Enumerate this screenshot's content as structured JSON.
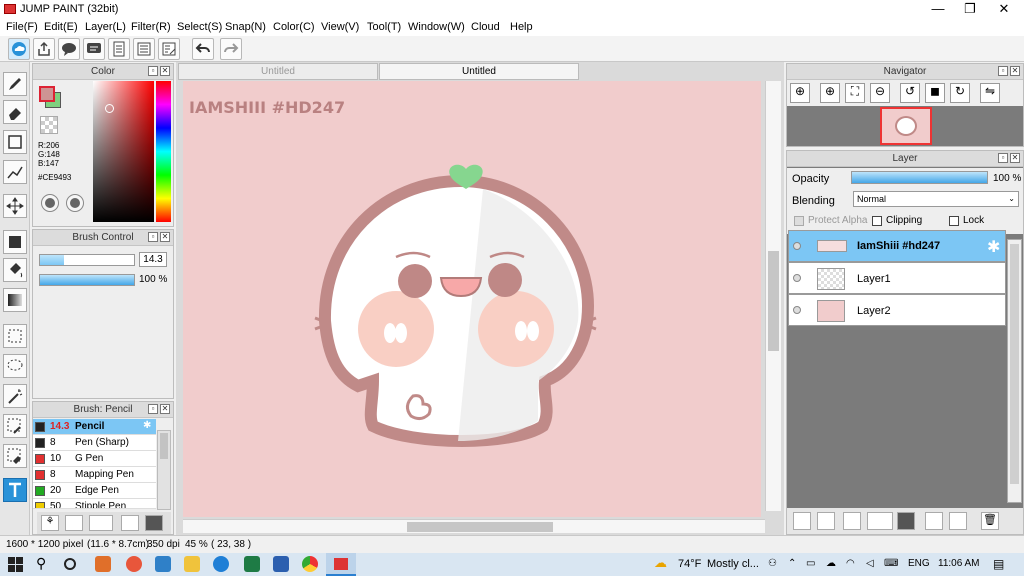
{
  "window": {
    "title": "JUMP PAINT (32bit)",
    "minimize": "—",
    "maximize": "❐",
    "close": "✕"
  },
  "menu": [
    "File(F)",
    "Edit(E)",
    "Layer(L)",
    "Filter(R)",
    "Select(S)",
    "Snap(N)",
    "Color(C)",
    "View(V)",
    "Tool(T)",
    "Window(W)",
    "Cloud",
    "Help"
  ],
  "color_panel": {
    "title": "Color",
    "r": "R:206",
    "g": "G:148",
    "b": "B:147",
    "hex": "#CE9493",
    "fg_color": "#CE9493",
    "bg_color": "#7fd07f"
  },
  "brush_control": {
    "title": "Brush Control",
    "size": "14.3",
    "opacity": "100 %",
    "size_fill": 0.25,
    "opacity_fill": 1.0
  },
  "brush_panel": {
    "title": "Brush: Pencil",
    "items": [
      {
        "size": "14.3",
        "name": "Pencil",
        "color": "#222222",
        "selected": true
      },
      {
        "size": "8",
        "name": "Pen (Sharp)",
        "color": "#222222"
      },
      {
        "size": "10",
        "name": "G Pen",
        "color": "#e23030"
      },
      {
        "size": "8",
        "name": "Mapping Pen",
        "color": "#e23030"
      },
      {
        "size": "20",
        "name": "Edge Pen",
        "color": "#22aa22"
      },
      {
        "size": "50",
        "name": "Stipple Pen",
        "color": "#eecc00"
      }
    ]
  },
  "tabs": {
    "inactive": "Untitled",
    "active": "Untitled"
  },
  "canvas": {
    "watermark": "IAMSHIII #HD247",
    "background": "#f1cccc"
  },
  "navigator": {
    "title": "Navigator"
  },
  "layer_panel": {
    "title": "Layer",
    "opacity_label": "Opacity",
    "opacity_value": "100 %",
    "opacity_fill": 1.0,
    "blending_label": "Blending",
    "blending_value": "Normal",
    "protect_alpha": "Protect Alpha",
    "clipping": "Clipping",
    "lock": "Lock",
    "layers": [
      {
        "name": "IamShiii #hd247",
        "selected": true
      },
      {
        "name": "Layer1"
      },
      {
        "name": "Layer2"
      }
    ]
  },
  "status": {
    "size": "1600 * 1200 pixel",
    "dims": "(11.6 * 8.7cm)",
    "dpi": "350 dpi",
    "zoom": "45 %",
    "coords": "( 23, 38 )"
  },
  "taskbar": {
    "weather_temp": "74°F",
    "weather_text": "Mostly cl...",
    "lang": "ENG",
    "time": "11:06 AM"
  }
}
